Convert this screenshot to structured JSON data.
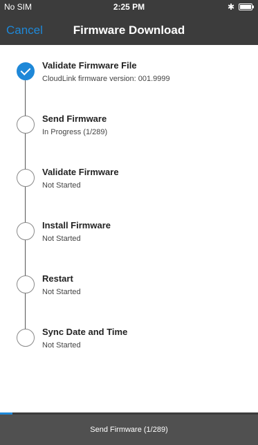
{
  "status_bar": {
    "carrier": "No SIM",
    "time": "2:25 PM",
    "bluetooth_icon": "bluetooth-icon",
    "battery_icon": "battery-icon"
  },
  "nav": {
    "cancel_label": "Cancel",
    "title": "Firmware Download"
  },
  "colors": {
    "accent": "#1e88d8",
    "bar_bg": "#3c3c3c",
    "bottom_bar_bg": "#505050"
  },
  "steps": [
    {
      "title": "Validate Firmware File",
      "status": "CloudLink firmware version: 001.9999",
      "state": "done"
    },
    {
      "title": "Send Firmware",
      "status": "In Progress (1/289)",
      "state": "in_progress"
    },
    {
      "title": "Validate Firmware",
      "status": "Not Started",
      "state": "pending"
    },
    {
      "title": "Install Firmware",
      "status": "Not Started",
      "state": "pending"
    },
    {
      "title": "Restart",
      "status": "Not Started",
      "state": "pending"
    },
    {
      "title": "Sync Date and Time",
      "status": "Not Started",
      "state": "pending"
    }
  ],
  "progress": {
    "current": 1,
    "total": 289,
    "label": "Send Firmware (1/289)"
  }
}
